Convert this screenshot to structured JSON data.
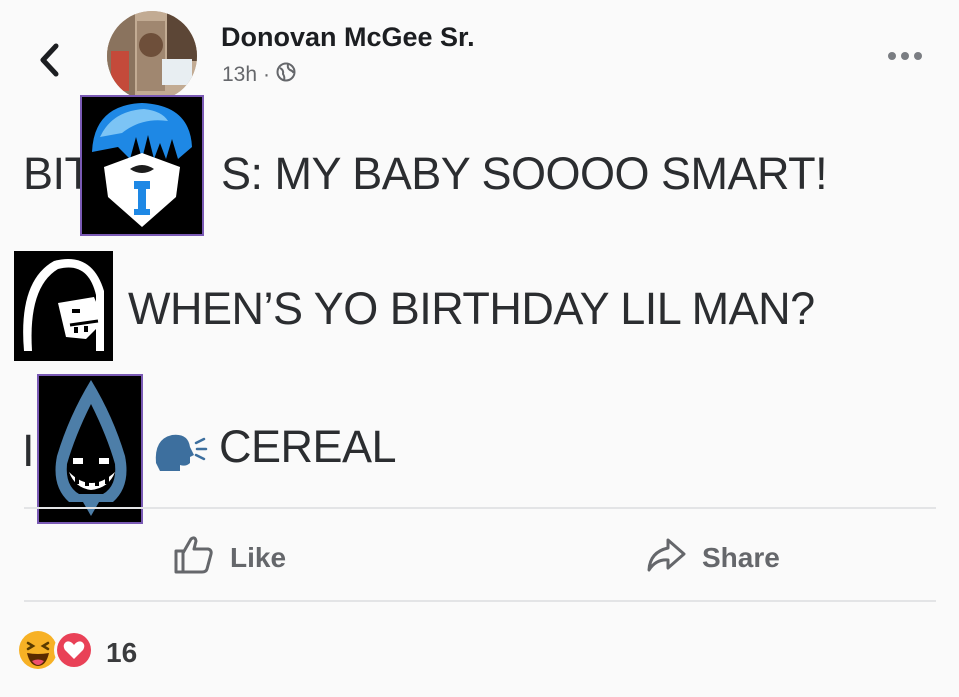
{
  "post": {
    "author": "Donovan McGee Sr.",
    "time": "13h",
    "separator": "·",
    "lines": {
      "line1_start": "BIT",
      "line1_end": "S: MY BABY SOOOO SMART!",
      "line2": "WHEN’S YO BIRTHDAY LIL MAN?",
      "line3_start": "I",
      "line3_end": "CEREAL"
    }
  },
  "actions": {
    "like_label": "Like",
    "share_label": "Share"
  },
  "reactions": {
    "count": "16",
    "icons": [
      "laugh-reaction-icon",
      "love-reaction-icon"
    ]
  },
  "colors": {
    "text": "#2b2d30",
    "muted": "#65676b",
    "sticker_border": "#7a5ab5",
    "blue_character": "#1e88e5",
    "love": "#e94157",
    "haha": "#f7b125"
  },
  "icons": {
    "back": "back-arrow-icon",
    "privacy": "globe-icon",
    "more": "more-options-icon",
    "like": "thumbs-up-icon",
    "share": "share-arrow-icon",
    "speaking": "speaking-head-icon"
  }
}
